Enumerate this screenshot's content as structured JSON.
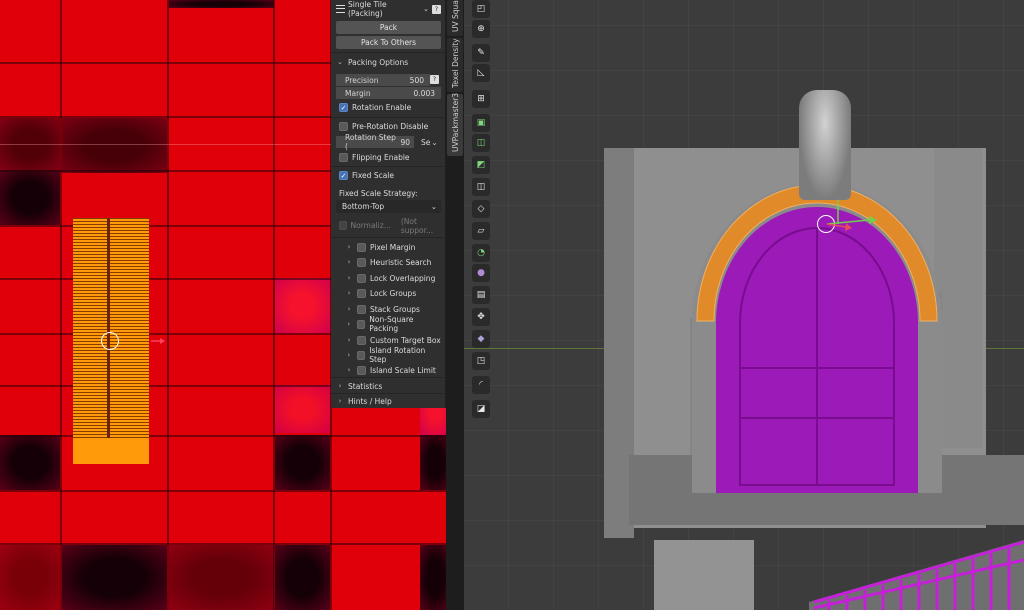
{
  "panel": {
    "mode_select": "Single Tile (Packing)",
    "help_icon": "?",
    "pack_button": "Pack",
    "pack_to_others_button": "Pack To Others",
    "packing_options_label": "Packing Options",
    "precision_label": "Precision",
    "precision_value": "500",
    "margin_label": "Margin",
    "margin_value": "0.003",
    "rotation_enable": {
      "label": "Rotation Enable",
      "checked": true
    },
    "pre_rotation_disable": {
      "label": "Pre-Rotation Disable",
      "checked": false
    },
    "rotation_step_label": "Rotation Step (",
    "rotation_step_value": "90",
    "rotation_step_suffix": "Se",
    "flipping_enable": {
      "label": "Flipping Enable",
      "checked": false
    },
    "fixed_scale": {
      "label": "Fixed Scale",
      "checked": true
    },
    "fixed_scale_strategy_label": "Fixed Scale Strategy:",
    "fixed_scale_strategy_value": "Bottom-Top",
    "normalize_label": "Normaliz...",
    "not_supported_label": "(Not suppor...",
    "subpanels": [
      {
        "label": "Pixel Margin"
      },
      {
        "label": "Heuristic Search"
      },
      {
        "label": "Lock Overlapping"
      },
      {
        "label": "Lock Groups"
      },
      {
        "label": "Stack Groups"
      },
      {
        "label": "Non-Square Packing"
      },
      {
        "label": "Custom Target Box"
      },
      {
        "label": "Island Rotation Step"
      },
      {
        "label": "Island Scale Limit"
      }
    ],
    "statistics_label": "Statistics",
    "hints_label": "Hints / Help"
  },
  "vertical_tabs": [
    {
      "label": "UV Square"
    },
    {
      "label": "Texel Density"
    },
    {
      "label": "UVPackmaster3"
    }
  ],
  "colors": {
    "uv_background": "#e0000a",
    "island_orange": "#ff9a0a",
    "selected_faces": "#a020c0",
    "arch_orange": "#e08a2a",
    "checkbox_on": "#4772b3"
  },
  "toolbar_icons": [
    "cursor-icon",
    "transform-icon",
    "annotate-icon",
    "measure-icon",
    "add-cube-icon",
    "extrude-icon",
    "inset-icon",
    "bevel-icon",
    "loop-cut-icon",
    "knife-icon",
    "poly-build-icon",
    "spin-icon",
    "smooth-icon",
    "edge-slide-icon",
    "shrink-icon",
    "shear-icon",
    "rip-icon"
  ]
}
